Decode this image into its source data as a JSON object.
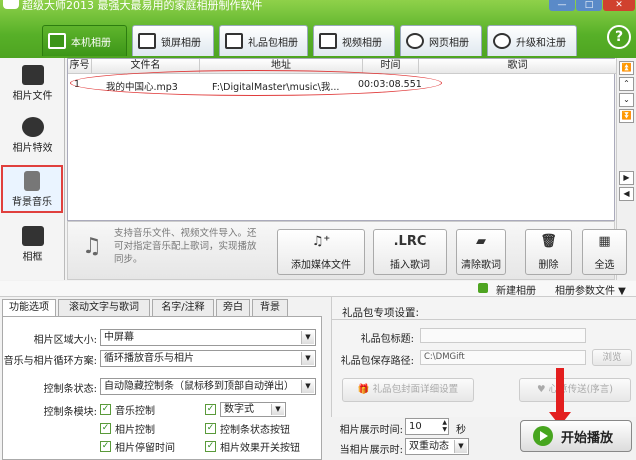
{
  "window": {
    "title": "超级大师2013   最强大最易用的家庭相册制作软件"
  },
  "top_tabs": [
    {
      "label": "本机相册",
      "icon": "folder-icon"
    },
    {
      "label": "锁屏相册",
      "icon": "monitor-icon"
    },
    {
      "label": "礼品包相册",
      "icon": "gift-icon"
    },
    {
      "label": "视频相册",
      "icon": "film-icon"
    },
    {
      "label": "网页相册",
      "icon": "browser-icon"
    },
    {
      "label": "升级和注册",
      "icon": "globe-icon"
    }
  ],
  "help_label": "?",
  "sidebar": [
    {
      "label": "相片文件",
      "icon": "camera-icon"
    },
    {
      "label": "相片特效",
      "icon": "sparkle-icon"
    },
    {
      "label": "背景音乐",
      "icon": "music-note-icon"
    },
    {
      "label": "相框",
      "icon": "frame-icon"
    }
  ],
  "table": {
    "columns": [
      "序号",
      "文件名",
      "地址",
      "时间",
      "歌词"
    ],
    "rows": [
      {
        "index": "1",
        "file": "我的中国心.mp3",
        "path": "F:\\DigitalMaster\\music\\我...",
        "time": "00:03:08.551",
        "lyrics": ""
      }
    ]
  },
  "action_bar": {
    "hint": "支持音乐文件、视频文件导入。还可对指定音乐配上歌词，实现播放同步。",
    "buttons": [
      {
        "label": "添加媒体文件",
        "icon": "add-media-icon"
      },
      {
        "label": "插入歌词",
        "icon": ".LRC"
      },
      {
        "label": "清除歌词",
        "icon": "eraser-icon"
      },
      {
        "label": "删除",
        "icon": "trash-icon"
      },
      {
        "label": "全选",
        "icon": "select-all-icon"
      }
    ]
  },
  "status_row": {
    "new_album": "新建相册",
    "params_file": "相册参数文件 ▼"
  },
  "bottom_tabs": [
    "功能选项",
    "滚动文字与歌词",
    "名字/注释",
    "旁白",
    "背景"
  ],
  "options": {
    "area_size_label": "相片区域大小:",
    "area_size_value": "中屏幕",
    "loop_label": "音乐与相片循环方案:",
    "loop_value": "循环播放音乐与相片",
    "control_bar_label": "控制条状态:",
    "control_bar_value": "自动隐藏控制条（鼠标移到顶部自动弹出）",
    "control_module_label": "控制条模块:",
    "checks": [
      {
        "label": "音乐控制",
        "checked": true
      },
      {
        "label": "数字式",
        "checked": true,
        "is_select": true
      },
      {
        "label": "相片控制",
        "checked": true
      },
      {
        "label": "控制条状态按钮",
        "checked": true
      },
      {
        "label": "相片停留时间",
        "checked": true
      },
      {
        "label": "相片效果开关按钮",
        "checked": true
      }
    ]
  },
  "gift": {
    "section_title": "礼品包专项设置:",
    "title_label": "礼品包标题:",
    "title_value": "",
    "path_label": "礼品包保存路径:",
    "path_value": "C:\\DMGift",
    "browse": "浏览",
    "cover_btn": "礼品包封面详细设置",
    "send_btn": "心意传送(序言)"
  },
  "timing": {
    "display_time_label": "相片展示时间:",
    "display_time_value": "10",
    "unit": "秒",
    "display_mode_label": "当相片展示时:",
    "display_mode_value": "双重动态"
  },
  "play_button": "开始播放"
}
